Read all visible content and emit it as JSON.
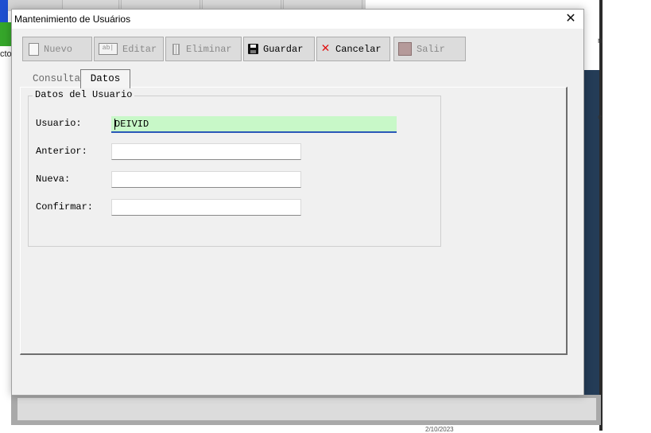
{
  "window": {
    "title": "Mantenimiento de Usuários",
    "close_icon": "close-icon"
  },
  "toolbar": {
    "buttons": [
      {
        "label": "Nuevo",
        "icon": "new-document-icon",
        "enabled": false
      },
      {
        "label": "Editar",
        "icon": "edit-field-icon",
        "enabled": false
      },
      {
        "label": "Eliminar",
        "icon": "trash-icon",
        "enabled": false
      },
      {
        "label": "Guardar",
        "icon": "floppy-disk-icon",
        "enabled": true
      },
      {
        "label": "Cancelar",
        "icon": "red-x-icon",
        "enabled": true
      },
      {
        "label": "Salir",
        "icon": "exit-icon",
        "enabled": false
      }
    ]
  },
  "tabs": {
    "items": [
      {
        "label": "Consulta",
        "active": false
      },
      {
        "label": "Datos",
        "active": true
      }
    ]
  },
  "form": {
    "group_title": "Datos del Usuario",
    "fields": [
      {
        "label": "Usuario:",
        "value": "DEIVID",
        "focused": true
      },
      {
        "label": "Anterior:",
        "value": ""
      },
      {
        "label": "Nueva:",
        "value": ""
      },
      {
        "label": "Confirmar:",
        "value": ""
      }
    ]
  },
  "background": {
    "partial_left_text": "cto",
    "bottom_text": "2/10/2023"
  },
  "colors": {
    "focused_field_bg": "#c8f8c8",
    "focused_field_underline": "#2a58b8",
    "cancel_icon": "#e01010",
    "background_app_dark": "#243c57"
  }
}
